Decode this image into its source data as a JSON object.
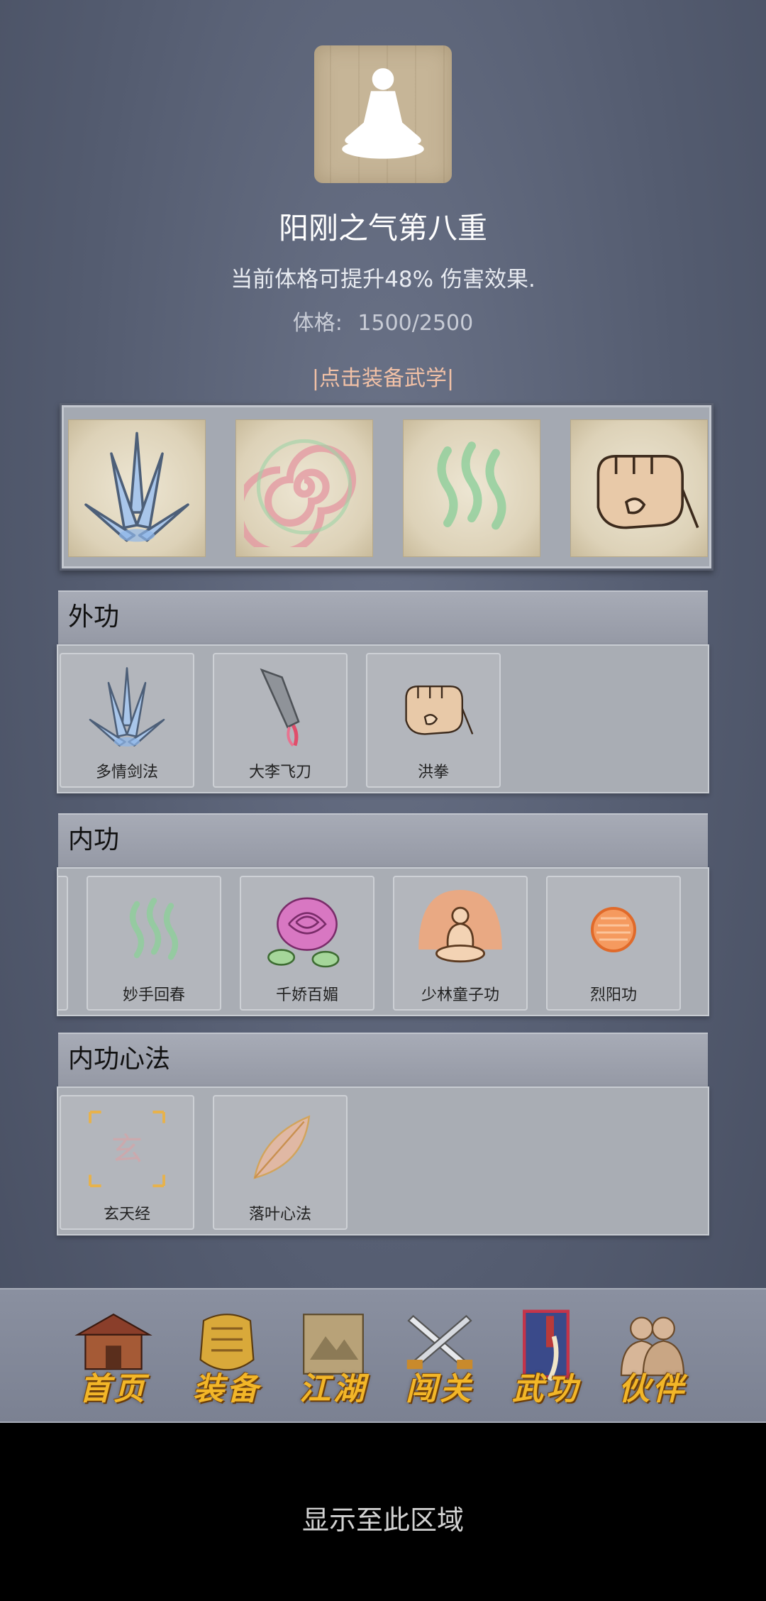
{
  "header": {
    "title": "阳刚之气第八重",
    "description": "当前体格可提升48% 伤害效果.",
    "stat_label": "体格:",
    "stat_value": "1500/2500",
    "equip_hint": "|点击装备武学|"
  },
  "equipped_slots": [
    {
      "icon": "blue-blades-icon"
    },
    {
      "icon": "pink-spiral-icon"
    },
    {
      "icon": "green-qi-icon"
    },
    {
      "icon": "fist-icon"
    }
  ],
  "sections": [
    {
      "title": "外功",
      "items": [
        {
          "label": "多情剑法",
          "icon": "blue-blades-icon"
        },
        {
          "label": "大李飞刀",
          "icon": "flying-knife-icon"
        },
        {
          "label": "洪拳",
          "icon": "fist-icon"
        }
      ]
    },
    {
      "title": "内功",
      "items": [
        {
          "label": "妙手回春",
          "icon": "green-qi-icon"
        },
        {
          "label": "千娇百媚",
          "icon": "rose-icon"
        },
        {
          "label": "少林童子功",
          "icon": "meditating-monk-icon"
        },
        {
          "label": "烈阳功",
          "icon": "orange-sun-icon"
        }
      ]
    },
    {
      "title": "内功心法",
      "items": [
        {
          "label": "玄天经",
          "icon": "xuan-scroll-icon"
        },
        {
          "label": "落叶心法",
          "icon": "falling-leaf-icon"
        }
      ]
    }
  ],
  "nav": [
    {
      "label": "首页",
      "icon": "temple-icon"
    },
    {
      "label": "装备",
      "icon": "armor-icon"
    },
    {
      "label": "江湖",
      "icon": "map-scroll-icon"
    },
    {
      "label": "闯关",
      "icon": "crossed-swords-icon"
    },
    {
      "label": "武功",
      "icon": "martial-book-icon"
    },
    {
      "label": "伙伴",
      "icon": "companions-icon"
    }
  ],
  "footer_text": "显示至此区域",
  "colors": {
    "background": "#545c70",
    "equip_hint": "#f2c1a6",
    "nav_label": "#f2b628"
  }
}
